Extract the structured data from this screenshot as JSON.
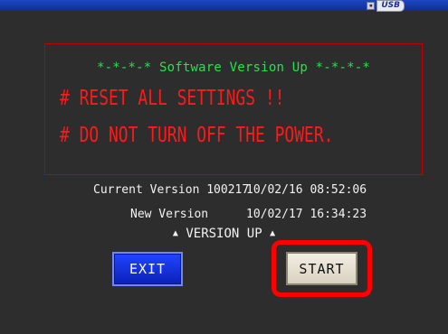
{
  "status_bar": {
    "usb_label": "USB",
    "usb_icon": "usb-icon"
  },
  "warning": {
    "title": "*-*-*-* Software Version Up *-*-*-*",
    "line1": "# RESET ALL SETTINGS !!",
    "line2": "# DO NOT TURN OFF THE POWER."
  },
  "versions": {
    "current_label": "Current Version 100217",
    "current_value": "10/02/16 08:52:06",
    "new_label": "New Version",
    "new_value": "10/02/17 16:34:23"
  },
  "prompt": {
    "arrow": "▲",
    "label": "VERSION UP"
  },
  "buttons": {
    "exit_label": "EXIT",
    "start_label": "START"
  },
  "colors": {
    "title_green": "#27e34a",
    "warning_red": "#ff1a1a",
    "highlight_red": "#ff0000",
    "exit_blue": "#1435e6",
    "background": "#2d2d2d"
  }
}
